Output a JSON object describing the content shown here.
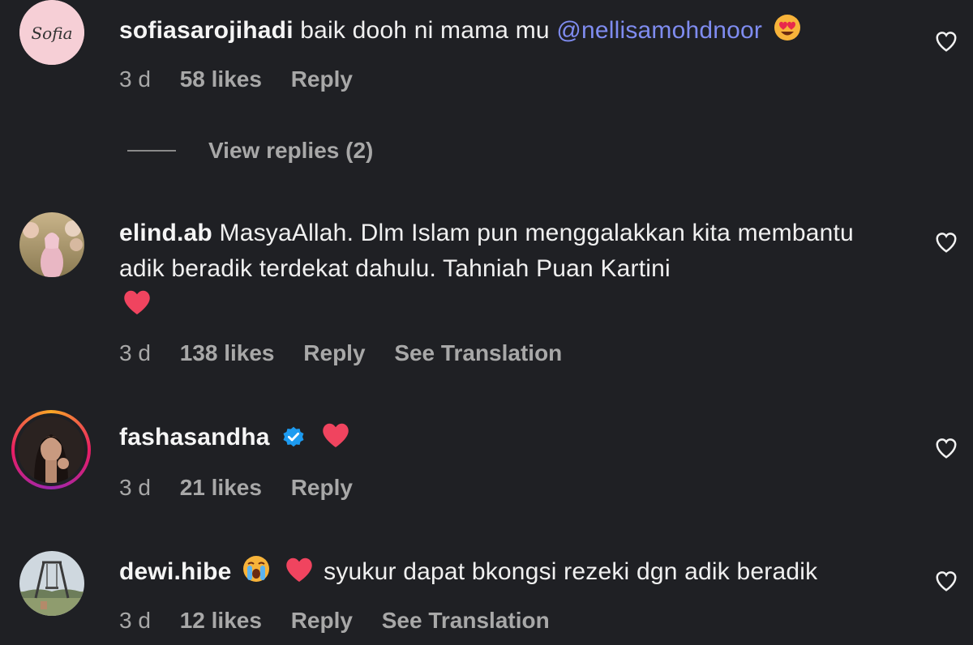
{
  "comments": [
    {
      "username": "sofiasarojihadi",
      "text": "baik dooh ni mama mu ",
      "mention": "@nellisamohdnoor",
      "avatar_text": "Sofia",
      "time": "3 d",
      "likes": "58 likes",
      "reply": "Reply",
      "view_replies": "View replies (2)"
    },
    {
      "username": "elind.ab",
      "text": "MasyaAllah. Dlm Islam pun menggalakkan kita membantu adik beradik terdekat dahulu. Tahniah Puan Kartini",
      "time": "3 d",
      "likes": "138 likes",
      "reply": "Reply",
      "translate": "See Translation"
    },
    {
      "username": "fashasandha",
      "time": "3 d",
      "likes": "21 likes",
      "reply": "Reply"
    },
    {
      "username": "dewi.hibe",
      "text": "syukur dapat bkongsi rezeki dgn adik beradik",
      "time": "3 d",
      "likes": "12 likes",
      "reply": "Reply",
      "translate": "See Translation"
    }
  ],
  "colors": {
    "background": "#1f2024",
    "mention": "#7f8cf0",
    "meta": "#a8a8a8",
    "verified": "#1d9bf0",
    "heart": "#f0445f"
  }
}
